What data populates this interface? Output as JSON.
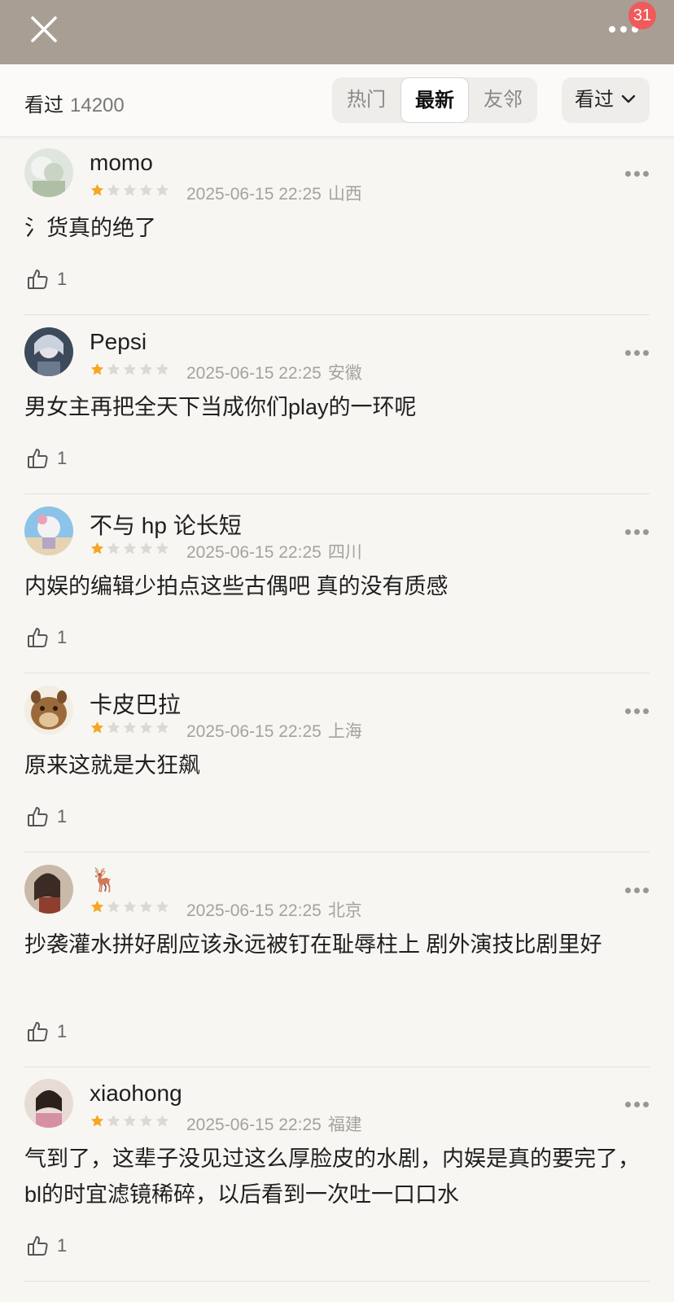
{
  "header": {
    "notification_count": "31"
  },
  "subbar": {
    "count_label": "看过",
    "count_value": "14200",
    "tabs": [
      {
        "label": "热门"
      },
      {
        "label": "最新"
      },
      {
        "label": "友邻"
      }
    ],
    "active_tab_index": 1,
    "filter_label": "看过"
  },
  "comments": [
    {
      "user": "momo",
      "rating": 1,
      "time": "2025-06-15 22:25",
      "location": "山西",
      "text": "氵货真的绝了",
      "likes": "1"
    },
    {
      "user": "Pepsi",
      "rating": 1,
      "time": "2025-06-15 22:25",
      "location": "安徽",
      "text": "男女主再把全天下当成你们play的一环呢",
      "likes": "1"
    },
    {
      "user": "不与 hp 论长短",
      "rating": 1,
      "time": "2025-06-15 22:25",
      "location": "四川",
      "text": "内娱的编辑少拍点这些古偶吧 真的没有质感",
      "likes": "1"
    },
    {
      "user": "卡皮巴拉",
      "rating": 1,
      "time": "2025-06-15 22:25",
      "location": "上海",
      "text": "原来这就是大狂飙",
      "likes": "1"
    },
    {
      "user": "🦌",
      "rating": 1,
      "time": "2025-06-15 22:25",
      "location": "北京",
      "text": "抄袭灌水拼好剧应该永远被钉在耻辱柱上 剧外演技比剧里好",
      "likes": "1"
    },
    {
      "user": "xiaohong",
      "rating": 1,
      "time": "2025-06-15 22:25",
      "location": "福建",
      "text": "气到了，这辈子没见过这么厚脸皮的水剧，内娱是真的要完了，bl的时宜滤镜稀碎，以后看到一次吐一口口水",
      "likes": "1"
    }
  ],
  "colors": {
    "topbar": "#a89e94",
    "star_filled": "#f5a623",
    "star_empty": "#dcd9d4",
    "badge": "#f05a5a"
  }
}
